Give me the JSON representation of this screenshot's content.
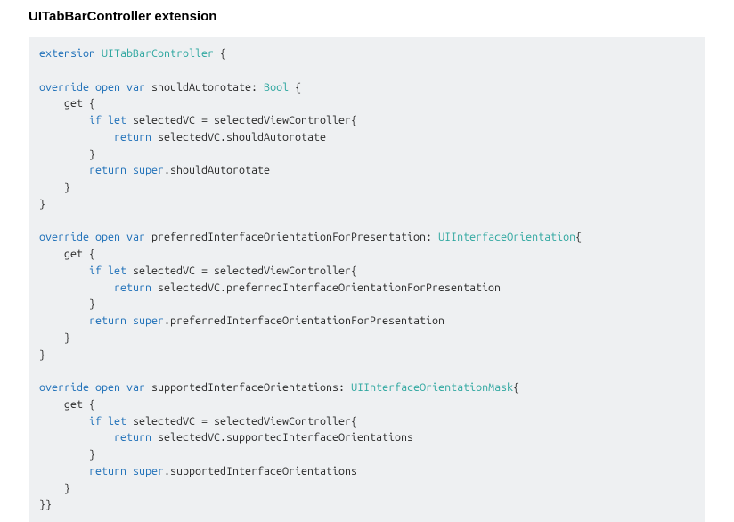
{
  "heading": "UITabBarController extension",
  "tokens": [
    {
      "t": "extension ",
      "c": "kw"
    },
    {
      "t": "UITabBarController",
      "c": "type"
    },
    {
      "t": " {"
    },
    {
      "t": "\n"
    },
    {
      "t": "\n"
    },
    {
      "t": "override ",
      "c": "kw"
    },
    {
      "t": "open ",
      "c": "kw"
    },
    {
      "t": "var ",
      "c": "kw"
    },
    {
      "t": "shouldAutorotate: "
    },
    {
      "t": "Bool",
      "c": "type"
    },
    {
      "t": " {"
    },
    {
      "t": "\n"
    },
    {
      "t": "    get {"
    },
    {
      "t": "\n"
    },
    {
      "t": "        "
    },
    {
      "t": "if let",
      "c": "kw"
    },
    {
      "t": " selectedVC = selectedViewController{"
    },
    {
      "t": "\n"
    },
    {
      "t": "            "
    },
    {
      "t": "return",
      "c": "kw"
    },
    {
      "t": " selectedVC.shouldAutorotate"
    },
    {
      "t": "\n"
    },
    {
      "t": "        }"
    },
    {
      "t": "\n"
    },
    {
      "t": "        "
    },
    {
      "t": "return super",
      "c": "kw"
    },
    {
      "t": ".shouldAutorotate"
    },
    {
      "t": "\n"
    },
    {
      "t": "    }"
    },
    {
      "t": "\n"
    },
    {
      "t": "}"
    },
    {
      "t": "\n"
    },
    {
      "t": "\n"
    },
    {
      "t": "override ",
      "c": "kw"
    },
    {
      "t": "open ",
      "c": "kw"
    },
    {
      "t": "var ",
      "c": "kw"
    },
    {
      "t": "preferredInterfaceOrientationForPresentation: "
    },
    {
      "t": "UIInterfaceOrientation",
      "c": "type"
    },
    {
      "t": "{"
    },
    {
      "t": "\n"
    },
    {
      "t": "    get {"
    },
    {
      "t": "\n"
    },
    {
      "t": "        "
    },
    {
      "t": "if let",
      "c": "kw"
    },
    {
      "t": " selectedVC = selectedViewController{"
    },
    {
      "t": "\n"
    },
    {
      "t": "            "
    },
    {
      "t": "return",
      "c": "kw"
    },
    {
      "t": " selectedVC.preferredInterfaceOrientationForPresentation"
    },
    {
      "t": "\n"
    },
    {
      "t": "        }"
    },
    {
      "t": "\n"
    },
    {
      "t": "        "
    },
    {
      "t": "return super",
      "c": "kw"
    },
    {
      "t": ".preferredInterfaceOrientationForPresentation"
    },
    {
      "t": "\n"
    },
    {
      "t": "    }"
    },
    {
      "t": "\n"
    },
    {
      "t": "}"
    },
    {
      "t": "\n"
    },
    {
      "t": "\n"
    },
    {
      "t": "override ",
      "c": "kw"
    },
    {
      "t": "open ",
      "c": "kw"
    },
    {
      "t": "var ",
      "c": "kw"
    },
    {
      "t": "supportedInterfaceOrientations: "
    },
    {
      "t": "UIInterfaceOrientationMask",
      "c": "type"
    },
    {
      "t": "{"
    },
    {
      "t": "\n"
    },
    {
      "t": "    get {"
    },
    {
      "t": "\n"
    },
    {
      "t": "        "
    },
    {
      "t": "if let",
      "c": "kw"
    },
    {
      "t": " selectedVC = selectedViewController{"
    },
    {
      "t": "\n"
    },
    {
      "t": "            "
    },
    {
      "t": "return",
      "c": "kw"
    },
    {
      "t": " selectedVC.supportedInterfaceOrientations"
    },
    {
      "t": "\n"
    },
    {
      "t": "        }"
    },
    {
      "t": "\n"
    },
    {
      "t": "        "
    },
    {
      "t": "return super",
      "c": "kw"
    },
    {
      "t": ".supportedInterfaceOrientations"
    },
    {
      "t": "\n"
    },
    {
      "t": "    }"
    },
    {
      "t": "\n"
    },
    {
      "t": "}}"
    }
  ]
}
